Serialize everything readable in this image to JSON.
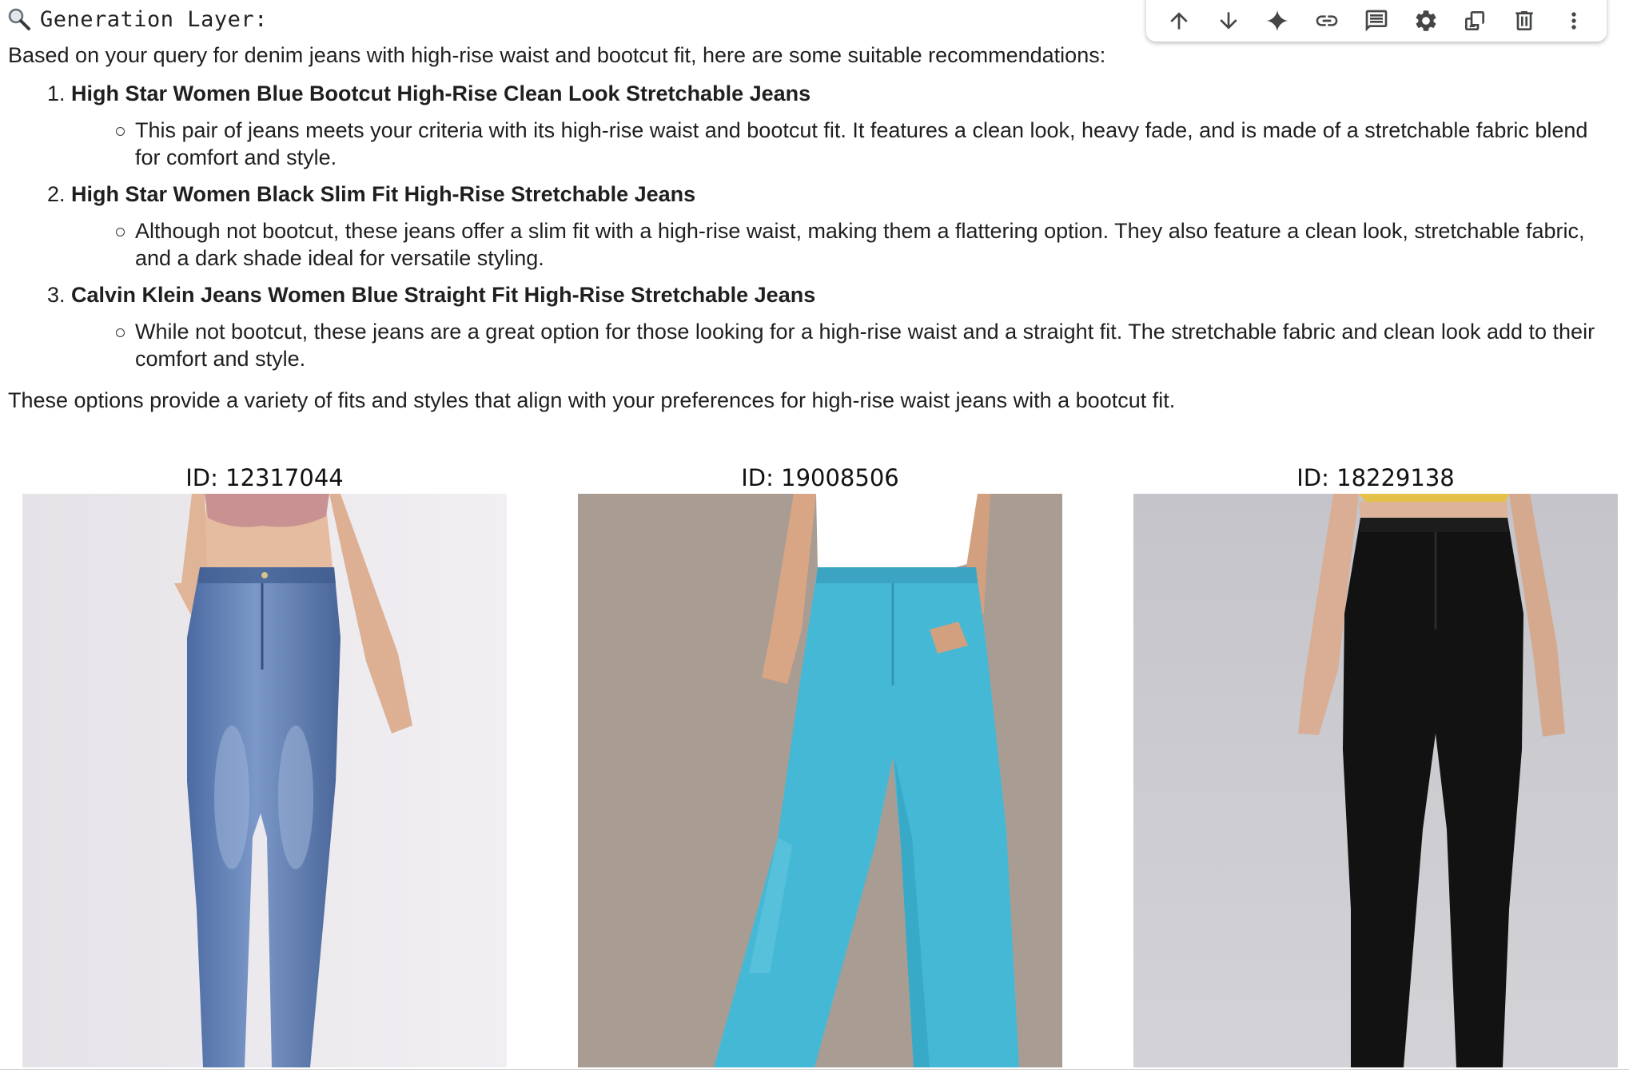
{
  "header": {
    "icon": "magnifier-icon",
    "title": "Generation Layer:"
  },
  "toolbar": {
    "buttons": [
      {
        "name": "move-up",
        "icon": "arrow-up-icon"
      },
      {
        "name": "move-down",
        "icon": "arrow-down-icon"
      },
      {
        "name": "gemini",
        "icon": "sparkle-icon"
      },
      {
        "name": "link",
        "icon": "link-icon"
      },
      {
        "name": "comment",
        "icon": "comment-icon"
      },
      {
        "name": "settings",
        "icon": "gear-icon"
      },
      {
        "name": "mirror",
        "icon": "mirror-cell-icon"
      },
      {
        "name": "delete",
        "icon": "trash-icon"
      },
      {
        "name": "more",
        "icon": "more-vert-icon"
      }
    ]
  },
  "response": {
    "intro": "Based on your query for denim jeans with high-rise waist and bootcut fit, here are some suitable recommendations:",
    "items": [
      {
        "title": "High Star Women Blue Bootcut High-Rise Clean Look Stretchable Jeans",
        "desc": "This pair of jeans meets your criteria with its high-rise waist and bootcut fit. It features a clean look, heavy fade, and is made of a stretchable fabric blend for comfort and style."
      },
      {
        "title": "High Star Women Black Slim Fit High-Rise Stretchable Jeans",
        "desc": "Although not bootcut, these jeans offer a slim fit with a high-rise waist, making them a flattering option. They also feature a clean look, stretchable fabric, and a dark shade ideal for versatile styling."
      },
      {
        "title": "Calvin Klein Jeans Women Blue Straight Fit High-Rise Stretchable Jeans",
        "desc": "While not bootcut, these jeans are a great option for those looking for a high-rise waist and a straight fit. The stretchable fabric and clean look add to their comfort and style."
      }
    ],
    "outro": "These options provide a variety of fits and styles that align with your preferences for high-rise waist jeans with a bootcut fit."
  },
  "images": [
    {
      "caption": "ID: 12317044",
      "colors": {
        "bg": "#ece9ee",
        "pants": "#5b7bb0",
        "top": "#c99696",
        "skin": "#e3b89c"
      }
    },
    {
      "caption": "ID: 19008506",
      "colors": {
        "bg": "#a89c92",
        "pants": "#43b8d6",
        "top": "#ffffff",
        "skin": "#d8a684"
      }
    },
    {
      "caption": "ID: 18229138",
      "colors": {
        "bg": "#c9c9ce",
        "pants": "#111111",
        "top": "#e6c34a",
        "skin": "#d9b096"
      }
    }
  ]
}
